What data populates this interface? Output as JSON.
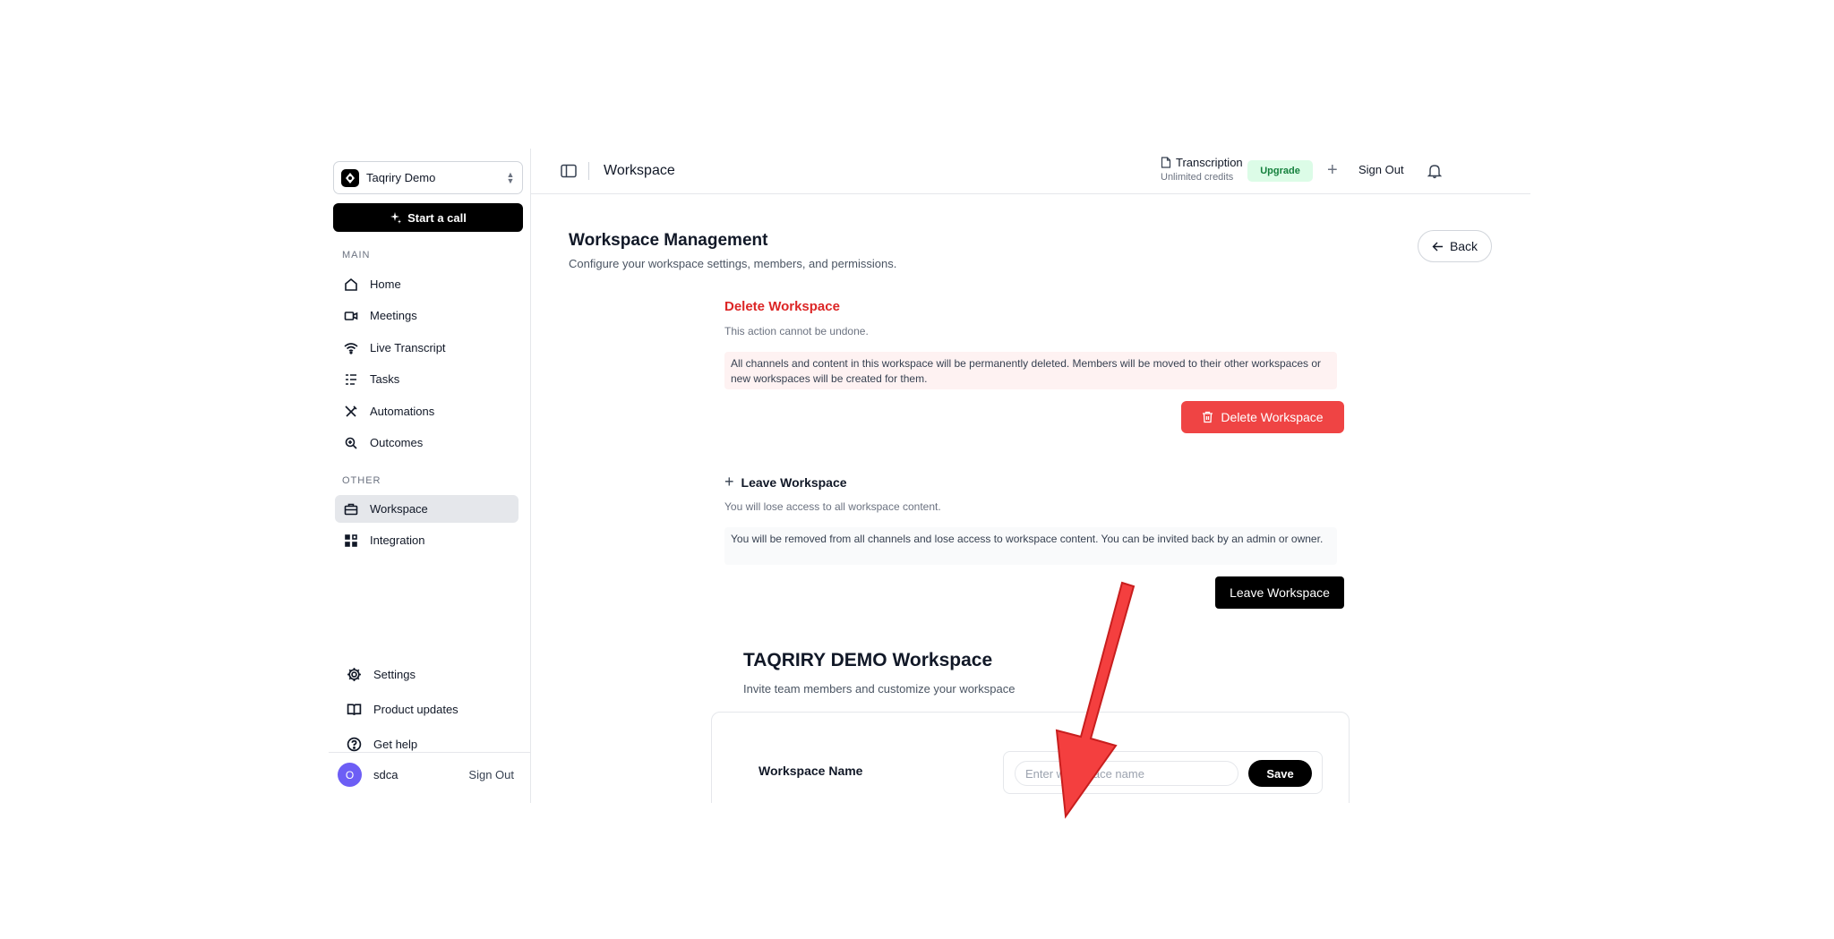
{
  "sidebar": {
    "workspace_name": "Taqriry Demo",
    "start_call_label": "Start a call",
    "main_section_label": "MAIN",
    "other_section_label": "OTHER",
    "main_items": [
      {
        "label": "Home",
        "icon": "home-icon"
      },
      {
        "label": "Meetings",
        "icon": "video-icon"
      },
      {
        "label": "Live Transcript",
        "icon": "wifi-icon"
      },
      {
        "label": "Tasks",
        "icon": "list-icon"
      },
      {
        "label": "Automations",
        "icon": "tools-icon"
      },
      {
        "label": "Outcomes",
        "icon": "search-zoom-icon"
      }
    ],
    "other_items": [
      {
        "label": "Workspace",
        "icon": "briefcase-icon",
        "active": true
      },
      {
        "label": "Integration",
        "icon": "grid-icon"
      }
    ],
    "bottom_items": [
      {
        "label": "Settings",
        "icon": "gear-icon"
      },
      {
        "label": "Product updates",
        "icon": "book-icon"
      },
      {
        "label": "Get help",
        "icon": "help-icon"
      }
    ],
    "user": {
      "initial": "O",
      "name": "sdca",
      "sign_out": "Sign Out"
    }
  },
  "header": {
    "title": "Workspace",
    "transcription_label": "Transcription",
    "transcription_sub": "Unlimited credits",
    "upgrade_label": "Upgrade",
    "sign_out_label": "Sign Out"
  },
  "main": {
    "title": "Workspace Management",
    "subtitle": "Configure your workspace settings, members, and permissions.",
    "back_label": "Back",
    "delete_section": {
      "title": "Delete Workspace",
      "subtitle": "This action cannot be undone.",
      "notice": "All channels and content in this workspace will be permanently deleted. Members will be moved to their other workspaces or new workspaces will be created for them.",
      "button_label": "Delete Workspace"
    },
    "leave_section": {
      "title": "Leave Workspace",
      "subtitle": "You will lose access to all workspace content.",
      "notice": "You will be removed from all channels and lose access to workspace content. You can be invited back by an admin or owner.",
      "button_label": "Leave Workspace"
    },
    "workspace_settings": {
      "title": "TAQRIRY DEMO Workspace",
      "subtitle": "Invite team members and customize your workspace",
      "name_label": "Workspace Name",
      "name_placeholder": "Enter workspace name",
      "name_value": "",
      "save_label": "Save"
    }
  },
  "colors": {
    "danger": "#ef4444",
    "danger_text": "#dc2626",
    "upgrade_bg": "#dcfce7",
    "upgrade_text": "#15803d",
    "avatar": "#6d5ef5",
    "annotation_arrow": "#f43f3f"
  }
}
